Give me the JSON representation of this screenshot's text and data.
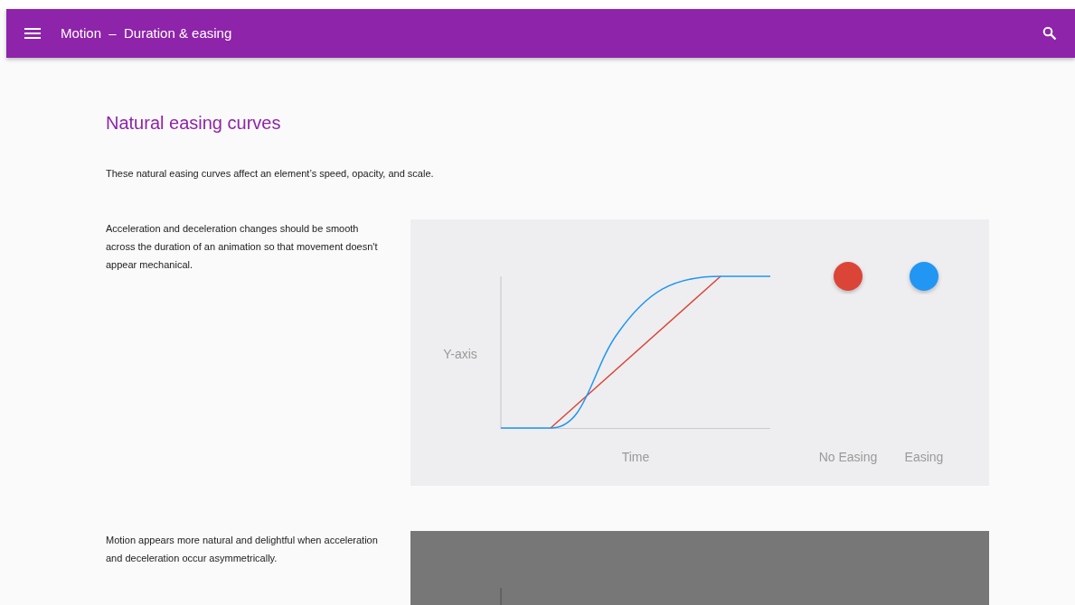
{
  "app_bar": {
    "title": "Motion",
    "separator": "–",
    "subtitle": "Duration & easing"
  },
  "heading": "Natural easing curves",
  "intro": "These natural easing curves affect an element’s speed, opacity, and scale.",
  "sections": [
    {
      "text": "Acceleration and deceleration changes should be smooth across the duration of an animation so that movement doesn't appear mechanical.",
      "demo": {
        "kind": "graph",
        "y_label": "Y-axis",
        "x_label": "Time",
        "balls": [
          {
            "label": "No Easing",
            "color": "#db4437"
          },
          {
            "label": "Easing",
            "color": "#2196f3"
          }
        ]
      }
    },
    {
      "text": "Motion appears more natural and delightful when acceleration and deceleration occur asymmetrically.",
      "demo": {
        "kind": "dark"
      }
    }
  ]
}
